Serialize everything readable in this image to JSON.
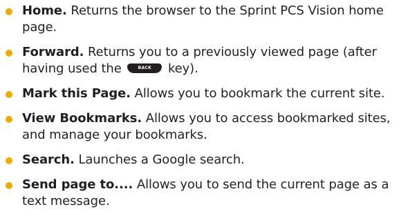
{
  "colors": {
    "bullet": "#f2a900",
    "text": "#231f20"
  },
  "items": [
    {
      "term": "Home.",
      "description": " Returns the browser to the Sprint PCS Vision home page."
    },
    {
      "term": "Forward.",
      "description_before_icon": " Returns you to a previously viewed page (after having used the",
      "icon": "back-key-icon",
      "icon_label": "BACK",
      "description_after_icon": " key)."
    },
    {
      "term": "Mark this Page.",
      "description": " Allows you to bookmark the current site."
    },
    {
      "term": "View Bookmarks.",
      "description": " Allows you to access bookmarked sites, and manage your bookmarks."
    },
    {
      "term": "Search.",
      "description": " Launches a Google search."
    },
    {
      "term": "Send page to....",
      "description": " Allows you to send the current page as a text message."
    }
  ]
}
